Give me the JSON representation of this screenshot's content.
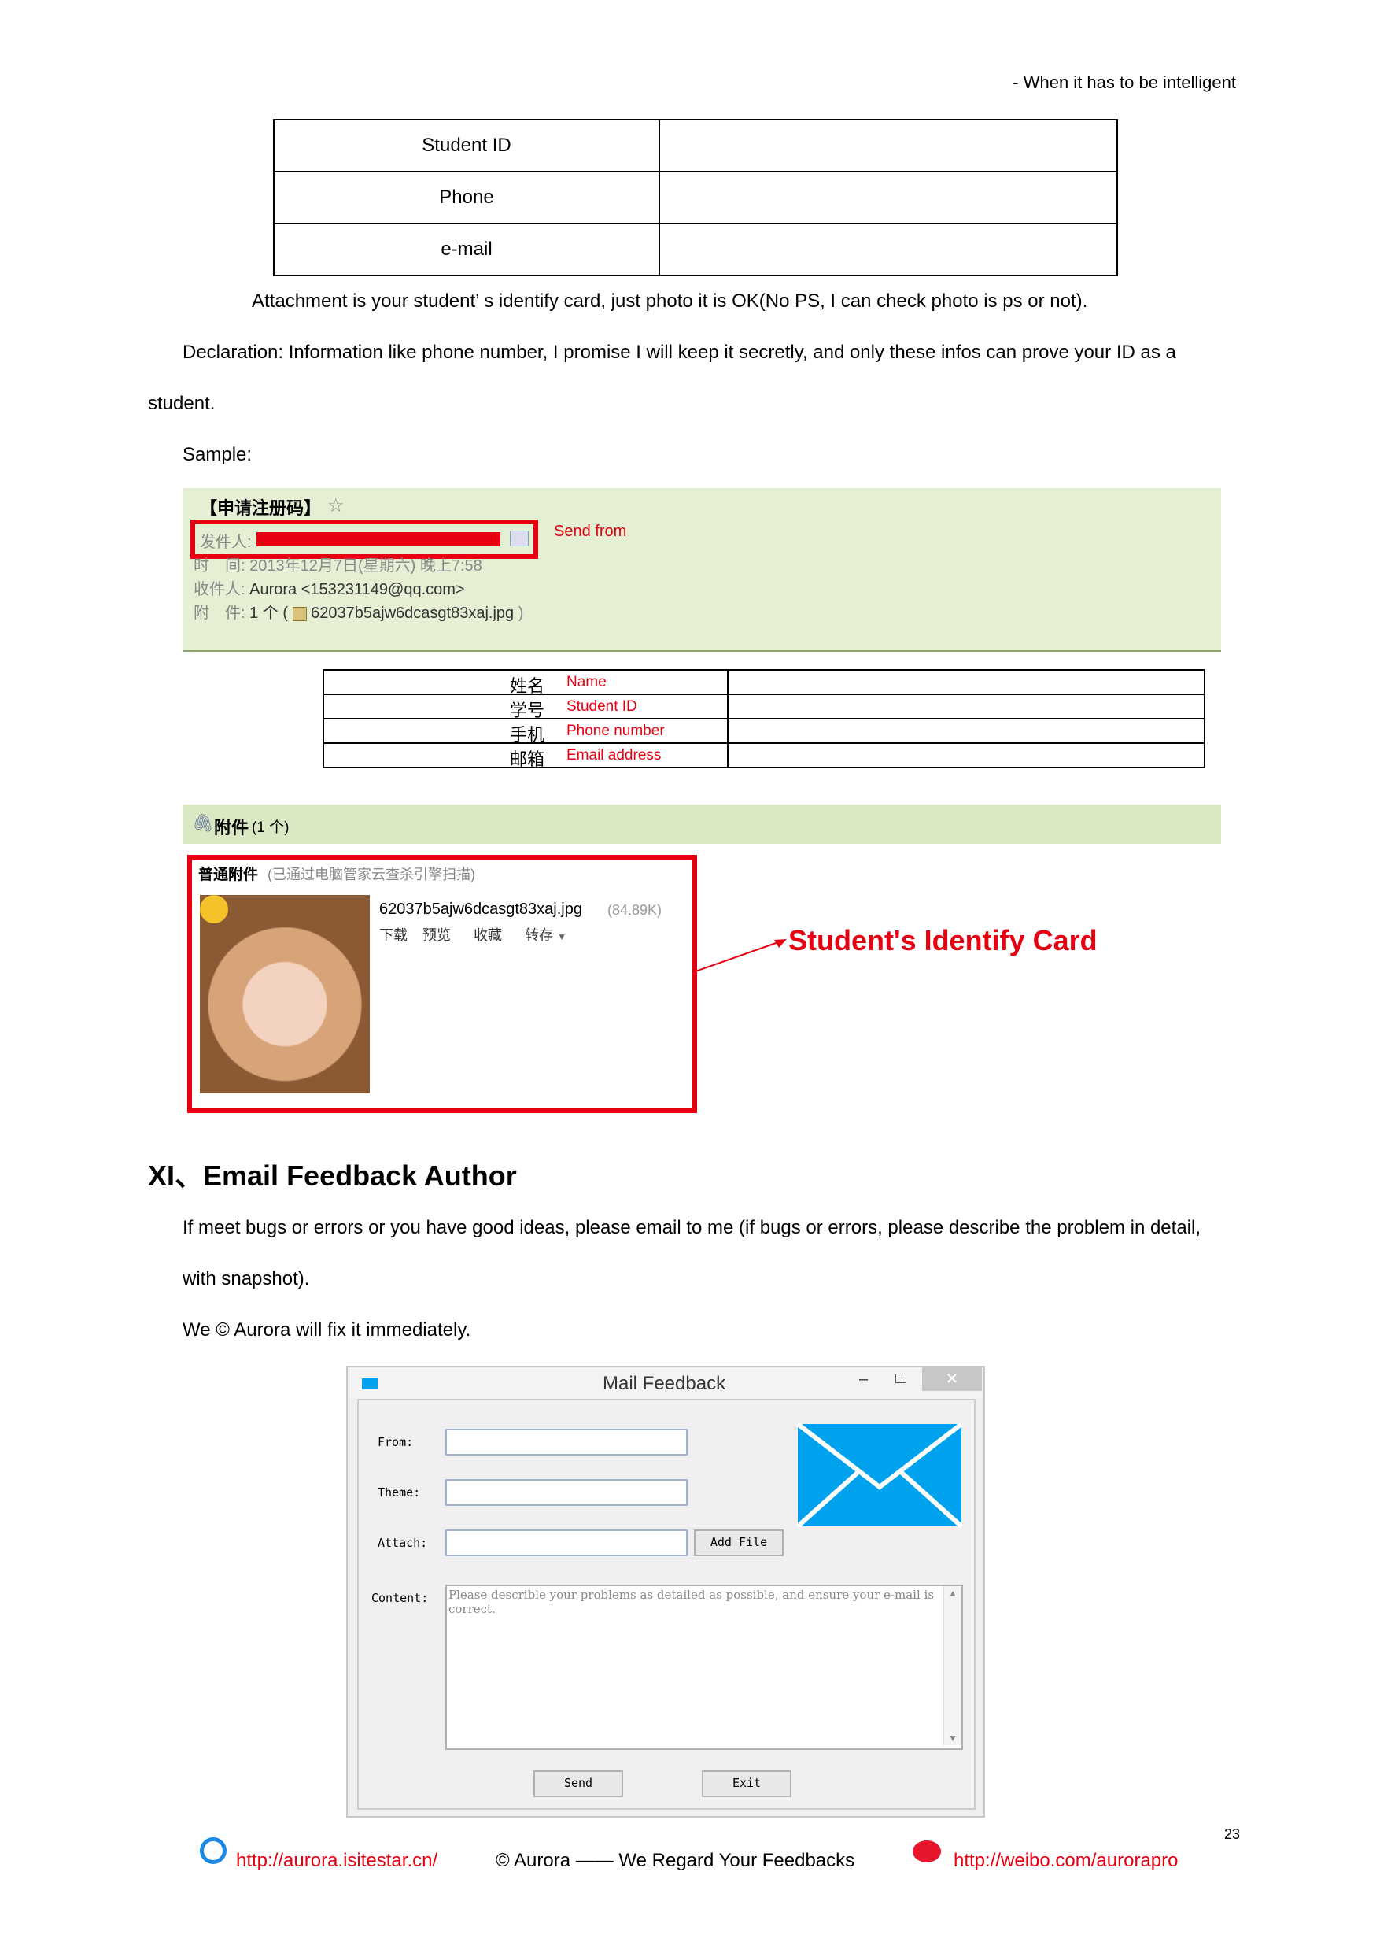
{
  "header": {
    "tagline": "- When it has to be intelligent"
  },
  "form_table": {
    "rows": [
      "Student ID",
      "Phone",
      "e-mail"
    ]
  },
  "para": {
    "attachment": "Attachment is your student’ s identify card, just photo it is OK(No PS, I can check photo is ps or not).",
    "declaration_1": "Declaration: Information like phone number, I promise I will keep it secretly, and only these infos can prove your ID as a",
    "declaration_2": "student.",
    "sample": "Sample:"
  },
  "sample_mail": {
    "subject": "【申请注册码】",
    "from_label": "发件人:",
    "send_from_note": "Send from",
    "time_label": "时　间:",
    "time_value": "2013年12月7日(星期六) 晚上7:58",
    "to_label": "收件人:",
    "to_value": "Aurora <153231149@qq.com>",
    "attach_label": "附　件:",
    "attach_count": "1 个 (",
    "attach_file": "62037b5ajw6dcasgt83xaj.jpg",
    "attach_close": ")"
  },
  "sample_table": {
    "rows": [
      {
        "cn": "姓名",
        "en": "Name"
      },
      {
        "cn": "学号",
        "en": "Student ID"
      },
      {
        "cn": "手机",
        "en": "Phone number"
      },
      {
        "cn": "邮箱",
        "en": "Email address"
      }
    ]
  },
  "attachment_panel": {
    "bar_label": "附件",
    "bar_count": "(1 个)",
    "normal_label": "普通附件",
    "scan_note": "(已通过电脑管家云查杀引擎扫描)",
    "file_name": "62037b5ajw6dcasgt83xaj.jpg",
    "file_size": "(84.89K)",
    "actions": [
      "下载",
      "预览",
      "收藏",
      "转存"
    ],
    "card_label": "Student's Identify Card"
  },
  "section": {
    "title": "XI、Email Feedback Author",
    "body_1": "If meet bugs or errors or you have good ideas, please email to me (if bugs or errors, please describe the problem in detail,",
    "body_2": "with snapshot).",
    "body_3": "We © Aurora will fix it immediately."
  },
  "window": {
    "title": "Mail Feedback",
    "from_label": "From:",
    "theme_label": "Theme:",
    "attach_label": "Attach:",
    "add_file": "Add File",
    "content_label": "Content:",
    "content_placeholder": "Please describle your problems as detailed as possible, and ensure your e-mail is correct.",
    "send": "Send",
    "exit": "Exit",
    "accent": "#00a2ed"
  },
  "page_number": "23",
  "footer": {
    "site": "http://aurora.isitestar.cn/",
    "center": "© Aurora —— We Regard Your Feedbacks",
    "weibo": "http://weibo.com/aurorapro"
  }
}
